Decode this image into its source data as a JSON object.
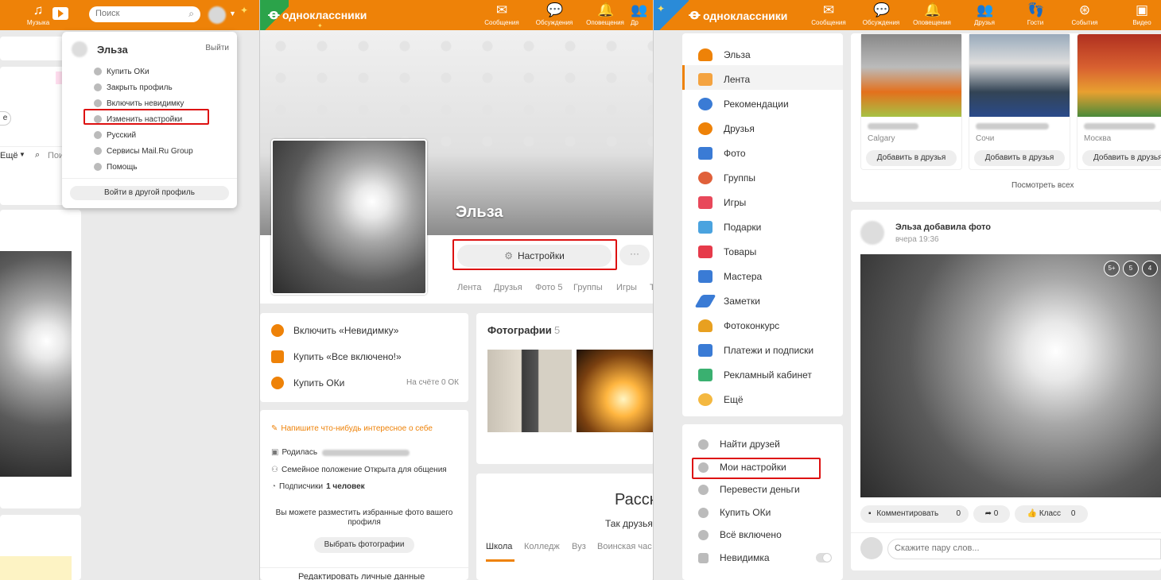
{
  "p1": {
    "nav_music": "Музыка",
    "search_placeholder": "Поиск",
    "btn_e": "е",
    "esche": "Ещё",
    "poi": "Пои",
    "dropdown": {
      "user": "Эльза",
      "logout": "Выйти",
      "items": [
        "Купить ОКи",
        "Закрыть профиль",
        "Включить невидимку",
        "Изменить настройки",
        "Русский",
        "Сервисы Mail.Ru Group",
        "Помощь"
      ],
      "other_profile": "Войти в другой профиль"
    }
  },
  "p2": {
    "brand": "одноклассники",
    "nav": [
      "Сообщения",
      "Обсуждения",
      "Оповещения",
      "Др"
    ],
    "name": "Эльза",
    "settings_btn": "Настройки",
    "more_btn": "···",
    "tabs": [
      "Лента",
      "Друзья",
      "Фото 5",
      "Группы",
      "Игры",
      "Т"
    ],
    "left_actions": [
      {
        "label": "Включить «Невидимку»",
        "color": "#ee8208"
      },
      {
        "label": "Купить «Все включено!»",
        "color": "#ee8208"
      },
      {
        "label": "Купить ОКи",
        "color": "#ee8208",
        "side": "На счёте 0 ОК"
      }
    ],
    "write_about": "Напишите что-нибудь интересное о себе",
    "born_label": "Родилась",
    "family": "Семейное положение Открыта для общения",
    "subs_label": "Подписчики",
    "subs_value": "1 человек",
    "fav_text": "Вы можете разместить избранные фото вашего профиля",
    "choose_photos": "Выбрать фотографии",
    "edit_data": "Редактировать личные данные",
    "photos_title": "Фотографии",
    "photos_count": "5",
    "rass": "Расск",
    "tak": "Так друзья",
    "school_tabs": [
      "Школа",
      "Колледж",
      "Вуз",
      "Воинская час"
    ]
  },
  "p3": {
    "brand": "одноклассники",
    "nav": [
      "Сообщения",
      "Обсуждения",
      "Оповещения",
      "Друзья",
      "Гости",
      "События",
      "Видео"
    ],
    "menu": [
      {
        "label": "Эльза",
        "color": "#ee8208"
      },
      {
        "label": "Лента",
        "color": "#f4a340"
      },
      {
        "label": "Рекомендации",
        "color": "#3a7bd5"
      },
      {
        "label": "Друзья",
        "color": "#ee8208"
      },
      {
        "label": "Фото",
        "color": "#3a7bd5"
      },
      {
        "label": "Группы",
        "color": "#e0603a"
      },
      {
        "label": "Игры",
        "color": "#e8485a"
      },
      {
        "label": "Подарки",
        "color": "#4aa3df"
      },
      {
        "label": "Товары",
        "color": "#e63a4a"
      },
      {
        "label": "Мастера",
        "color": "#3a7bd5"
      },
      {
        "label": "Заметки",
        "color": "#3a7bd5"
      },
      {
        "label": "Фотоконкурс",
        "color": "#e8a020"
      },
      {
        "label": "Платежи и подписки",
        "color": "#3a7bd5"
      },
      {
        "label": "Рекламный кабинет",
        "color": "#3ab070"
      },
      {
        "label": "Ещё",
        "color": "#f4b840"
      }
    ],
    "submenu": [
      "Найти друзей",
      "Мои настройки",
      "Перевести деньги",
      "Купить ОКи",
      "Всё включено",
      "Невидимка"
    ],
    "friends": [
      {
        "city": "Calgary",
        "btn": "Добавить в друзья"
      },
      {
        "city": "Сочи",
        "btn": "Добавить в друзья"
      },
      {
        "city": "Москва",
        "btn": "Добавить в друзья"
      }
    ],
    "see_all": "Посмотреть всех",
    "post_author": "Эльза добавила фото",
    "post_time": "вчера 19:36",
    "badges": [
      "5+",
      "5",
      "4"
    ],
    "comment": "Комментировать",
    "comment_count": "0",
    "share_count": "0",
    "klass": "Класс",
    "klass_count": "0",
    "say_placeholder": "Скажите пару слов..."
  }
}
